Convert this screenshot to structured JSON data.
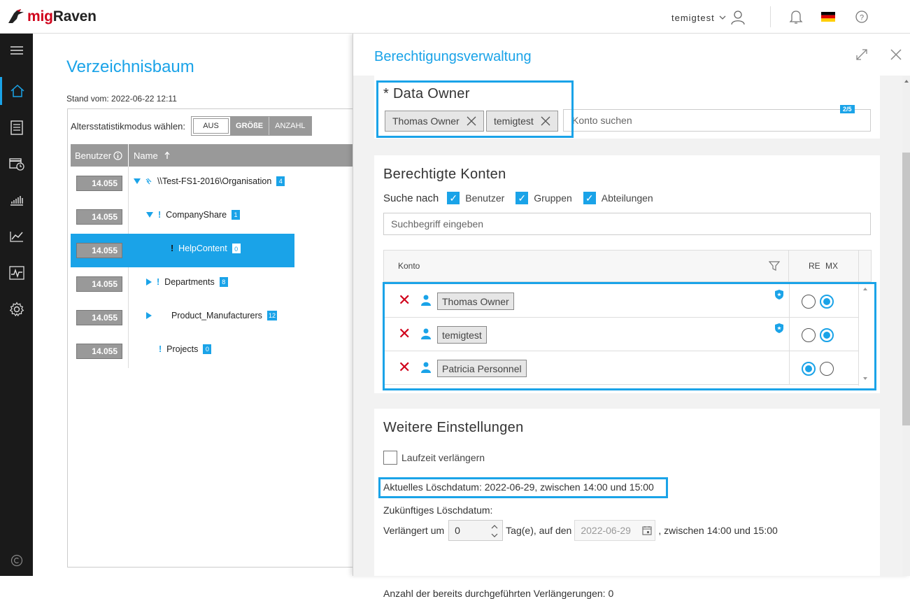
{
  "app": {
    "name_prefix": "mig",
    "name_suffix": "Raven"
  },
  "topbar": {
    "username": "temigtest"
  },
  "left": {
    "title": "Verzeichnisbaum",
    "stand": "Stand vom: 2022-06-22 12:11",
    "alters_label": "Altersstatistikmodus wählen:",
    "alters_options": [
      "AUS",
      "GRÖßE",
      "ANZAHL"
    ],
    "col_benutzer": "Benutzer",
    "col_name": "Name",
    "rows": [
      {
        "badge": "14.055",
        "name": "\\\\Test-FS1-2016\\Organisation",
        "count": "4"
      },
      {
        "badge": "14.055",
        "name": "CompanyShare",
        "count": "1"
      },
      {
        "badge": "14.055",
        "name": "HelpContent",
        "count": "0"
      },
      {
        "badge": "14.055",
        "name": "Departments",
        "count": "8"
      },
      {
        "badge": "14.055",
        "name": "Product_Manufacturers",
        "count": "12"
      },
      {
        "badge": "14.055",
        "name": "Projects",
        "count": "0"
      }
    ]
  },
  "drawer": {
    "title": "Berechtigungsverwaltung",
    "data_owner": {
      "heading": "* Data Owner",
      "tags": [
        "Thomas Owner",
        "temigtest"
      ],
      "placeholder": "Konto suchen",
      "counter": "2/5"
    },
    "konten": {
      "heading": "Berechtigte Konten",
      "suche_label": "Suche nach",
      "filters": [
        "Benutzer",
        "Gruppen",
        "Abteilungen"
      ],
      "search_placeholder": "Suchbegriff eingeben",
      "col_konto": "Konto",
      "col_re": "RE",
      "col_mx": "MX",
      "accounts": [
        {
          "name": "Thomas Owner",
          "owner": true,
          "re": false,
          "mx": true
        },
        {
          "name": "temigtest",
          "owner": true,
          "re": false,
          "mx": true
        },
        {
          "name": "Patricia Personnel",
          "owner": false,
          "re": true,
          "mx": false
        }
      ]
    },
    "weitere": {
      "heading": "Weitere Einstellungen",
      "laufzeit": "Laufzeit verlängern",
      "aktuelles": "Aktuelles Löschdatum: 2022-06-29, zwischen 14:00 und 15:00",
      "zukuenftiges": "Zukünftiges Löschdatum:",
      "verlaengert_um": "Verlängert um",
      "tage_value": "0",
      "tag_suffix": "Tag(e), auf den",
      "date_value": "2022-06-29",
      "zeit_suffix": ", zwischen 14:00 und 15:00",
      "anzahl": "Anzahl der bereits durchgeführten Verlängerungen: 0"
    }
  },
  "colors": {
    "accent": "#1aa3e8",
    "danger": "#d0021b",
    "sidebar": "#1a1a1a"
  }
}
